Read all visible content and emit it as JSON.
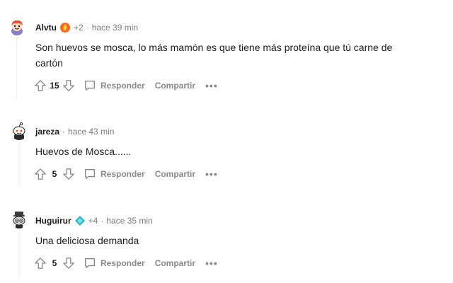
{
  "comments": [
    {
      "author": "Alvtu",
      "flair_icon": "flame-badge-icon",
      "extra": "+2",
      "separator": "·",
      "time": "hace 39 min",
      "body": "Son huevos se mosca, lo más mamón es que tiene más proteína que tú carne de cartón",
      "score": "15",
      "reply_label": "Responder",
      "share_label": "Compartir"
    },
    {
      "author": "jareza",
      "separator": "·",
      "time": "hace 43 min",
      "body": "Huevos de Mosca......",
      "score": "5",
      "reply_label": "Responder",
      "share_label": "Compartir"
    },
    {
      "author": "Huguirur",
      "flair_icon": "diamond-badge-icon",
      "extra": "+4",
      "separator": "·",
      "time": "hace 35 min",
      "body": "Una deliciosa demanda",
      "score": "5",
      "reply_label": "Responder",
      "share_label": "Compartir"
    }
  ],
  "colors": {
    "text": "#1c1c1c",
    "muted": "#7c7c7c",
    "action": "#878a8c",
    "thread_line": "#edeff1"
  }
}
